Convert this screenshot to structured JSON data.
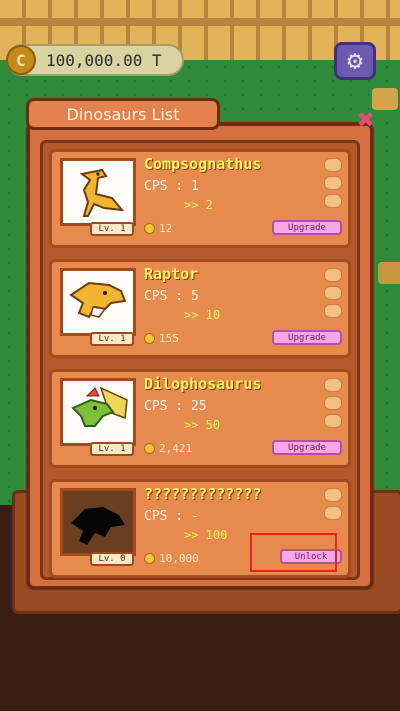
{
  "currency": {
    "amount": "100,000.00 T",
    "symbol": "C"
  },
  "settings": {
    "icon": "gear-icon"
  },
  "panel": {
    "title": "Dinosaurs List",
    "close_icon": "close-icon"
  },
  "dinosaurs": [
    {
      "name": "Compsognathus",
      "cps": "CPS : 1",
      "cps_next": ">> 2",
      "cost": "12",
      "level": "Lv. 1",
      "button": "Upgrade",
      "locked": false
    },
    {
      "name": "Raptor",
      "cps": "CPS : 5",
      "cps_next": ">> 10",
      "cost": "155",
      "level": "Lv. 1",
      "button": "Upgrade",
      "locked": false
    },
    {
      "name": "Dilophosaurus",
      "cps": "CPS : 25",
      "cps_next": ">> 50",
      "cost": "2,421",
      "level": "Lv. 1",
      "button": "Upgrade",
      "locked": false
    },
    {
      "name": "?????????????",
      "cps": "CPS : -",
      "cps_next": ">> 100",
      "cost": "10,000",
      "level": "Lv. 0",
      "button": "Unlock",
      "locked": true
    }
  ],
  "colors": {
    "accent": "#d7703f",
    "button": "#f7a6e6",
    "highlight": "#e0261f"
  }
}
